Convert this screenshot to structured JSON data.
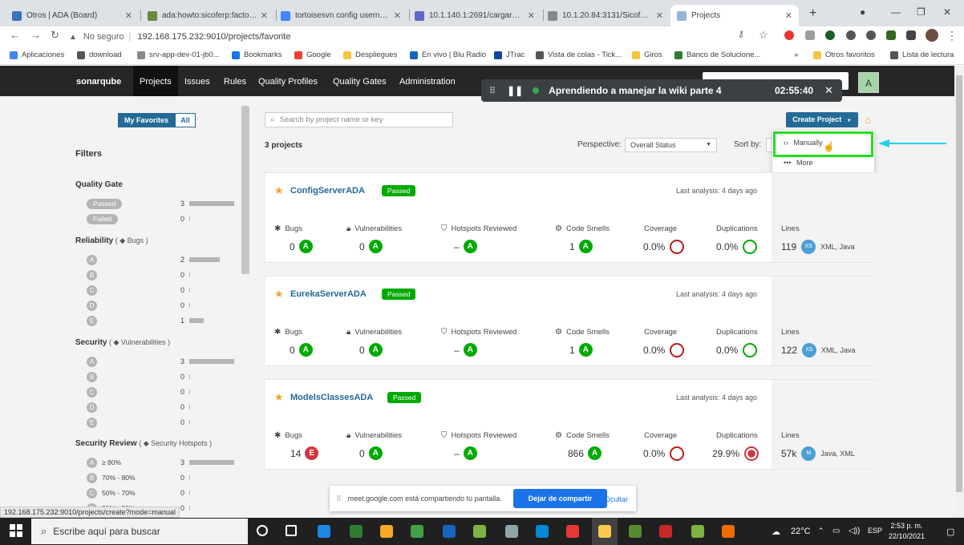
{
  "browser": {
    "tabs": [
      {
        "title": "Otros | ADA (Board)",
        "color": "#3b73b9"
      },
      {
        "title": "ada:howto:sicoferp:factory:...",
        "color": "#6a8a3a"
      },
      {
        "title": "tortoisesvn config username...",
        "color": "#4285f4"
      },
      {
        "title": "10.1.140.1:2691/cargarArch...",
        "color": "#5c6bc0"
      },
      {
        "title": "10.1.20.84:3131/SicofMobil...",
        "color": "#888888"
      },
      {
        "title": "Projects",
        "color": "#8fb7d8"
      }
    ],
    "new_tab": "+",
    "url_not_secure": "No seguro",
    "url": "192.168.175.232:9010/projects/favorite",
    "bookmarks": [
      {
        "label": "Aplicaciones",
        "color": "#4285f4"
      },
      {
        "label": "download",
        "color": "#555555"
      },
      {
        "label": "srv-app-dev-01-jb0...",
        "color": "#888888"
      },
      {
        "label": "Bookmarks",
        "color": "#1a73e8"
      },
      {
        "label": "Google",
        "color": "#ea4335"
      },
      {
        "label": "Despliegues",
        "color": "#f4c542"
      },
      {
        "label": "En vivo | Blu Radio",
        "color": "#1565c0"
      },
      {
        "label": "JTrac",
        "color": "#0d47a1"
      },
      {
        "label": "Vista de colas - Tick...",
        "color": "#555555"
      },
      {
        "label": "Giros",
        "color": "#f4c542"
      },
      {
        "label": "Banco de Solucione...",
        "color": "#2e7d32"
      },
      {
        "label": "»",
        "color": "#ffffff"
      },
      {
        "label": "Otros favoritos",
        "color": "#f4c542"
      },
      {
        "label": "Lista de lectura",
        "color": "#555555"
      }
    ]
  },
  "sonar": {
    "logo": "sonarqube",
    "nav": [
      "Projects",
      "Issues",
      "Rules",
      "Quality Profiles",
      "Quality Gates",
      "Administration"
    ],
    "avatar": "A"
  },
  "meet_bar": {
    "title": "Aprendiendo a manejar la wiki parte 4",
    "time": "02:55:40"
  },
  "sidebar": {
    "toggle": [
      "My Favorites",
      "All"
    ],
    "filters_title": "Filters",
    "quality_gate": {
      "title": "Quality Gate",
      "rows": [
        {
          "label": "Passed",
          "count": "3",
          "fill": 1.0
        },
        {
          "label": "Failed",
          "count": "0",
          "fill": 0
        }
      ]
    },
    "reliability": {
      "title": "Reliability",
      "sub": "Bugs",
      "rows": [
        {
          "label": "A",
          "count": "2",
          "fill": 0.67
        },
        {
          "label": "B",
          "count": "0",
          "fill": 0
        },
        {
          "label": "C",
          "count": "0",
          "fill": 0
        },
        {
          "label": "D",
          "count": "0",
          "fill": 0
        },
        {
          "label": "E",
          "count": "1",
          "fill": 0.33
        }
      ]
    },
    "security": {
      "title": "Security",
      "sub": "Vulnerabilities",
      "rows": [
        {
          "label": "A",
          "count": "3",
          "fill": 1.0
        },
        {
          "label": "B",
          "count": "0",
          "fill": 0
        },
        {
          "label": "C",
          "count": "0",
          "fill": 0
        },
        {
          "label": "D",
          "count": "0",
          "fill": 0
        },
        {
          "label": "E",
          "count": "0",
          "fill": 0
        }
      ]
    },
    "security_review": {
      "title": "Security Review",
      "sub": "Security Hotspots",
      "rows": [
        {
          "label": "A",
          "range": "≥ 80%",
          "count": "3",
          "fill": 1.0
        },
        {
          "label": "B",
          "range": "70% - 80%",
          "count": "0",
          "fill": 0
        },
        {
          "label": "C",
          "range": "50% - 70%",
          "count": "0",
          "fill": 0
        },
        {
          "label": "D",
          "range": "30% - 50%",
          "count": "0",
          "fill": 0
        }
      ]
    }
  },
  "main": {
    "search_placeholder": "Search by project name or key",
    "count": "3 projects",
    "perspective_label": "Perspective:",
    "perspective_value": "Overall Status",
    "sort_label": "Sort by:",
    "create_button": "Create Project",
    "dropdown": [
      "Manually",
      "More"
    ],
    "metric_labels": {
      "bugs": "Bugs",
      "vulns": "Vulnerabilities",
      "hotspots": "Hotspots Reviewed",
      "smells": "Code Smells",
      "coverage": "Coverage",
      "dups": "Duplications",
      "lines": "Lines"
    },
    "projects": [
      {
        "name": "ConfigServerADA",
        "gate": "Passed",
        "last": "Last analysis: 4 days ago",
        "bugs": "0",
        "bugs_rating": "A",
        "vulns": "0",
        "vulns_rating": "A",
        "hotspots": "–",
        "hotspots_rating": "A",
        "smells": "1",
        "smells_rating": "A",
        "coverage": "0.0%",
        "dups": "0.0%",
        "lines": "119",
        "size": "XS",
        "languages": "XML, Java"
      },
      {
        "name": "EurekaServerADA",
        "gate": "Passed",
        "last": "Last analysis: 4 days ago",
        "bugs": "0",
        "bugs_rating": "A",
        "vulns": "0",
        "vulns_rating": "A",
        "hotspots": "–",
        "hotspots_rating": "A",
        "smells": "1",
        "smells_rating": "A",
        "coverage": "0.0%",
        "dups": "0.0%",
        "lines": "122",
        "size": "XS",
        "languages": "XML, Java"
      },
      {
        "name": "ModelsClassesADA",
        "gate": "Passed",
        "last": "Last analysis: 4 days ago",
        "bugs": "14",
        "bugs_rating": "E",
        "vulns": "0",
        "vulns_rating": "A",
        "hotspots": "–",
        "hotspots_rating": "A",
        "smells": "866",
        "smells_rating": "A",
        "coverage": "0.0%",
        "dups": "29.9%",
        "lines": "57k",
        "size": "M",
        "languages": "Java, XML"
      }
    ]
  },
  "share_bar": {
    "text": "meet.google.com está compartiendo tu pantalla.",
    "stop": "Dejar de compartir",
    "hide": "Ocultar"
  },
  "status_url": "192.168.175.232:9010/projects/create?mode=manual",
  "taskbar": {
    "search": "Escribe aquí para buscar",
    "temp": "22°C",
    "lang": "ESP",
    "time": "2:53 p. m.",
    "date": "22/10/2021"
  },
  "colors": {
    "rating_a": "#00aa00",
    "rating_e": "#d4333f",
    "accent": "#236a97",
    "highlight": "#22dd22",
    "arrow": "#22d3e8"
  }
}
